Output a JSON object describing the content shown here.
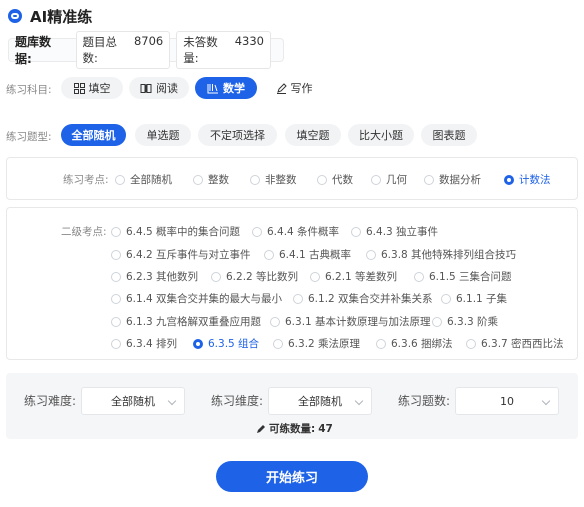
{
  "header": {
    "title": "AI精准练"
  },
  "stats": {
    "label": "题库数据:",
    "total_label": "题目总数:",
    "total_value": "8706",
    "unanswered_label": "未答数量:",
    "unanswered_value": "4330"
  },
  "subject": {
    "label": "练习科目:",
    "items": [
      {
        "label": "填空",
        "icon": "grid-icon"
      },
      {
        "label": "阅读",
        "icon": "book-icon"
      },
      {
        "label": "数学",
        "icon": "math-book-icon",
        "active": true
      },
      {
        "label": "写作",
        "icon": "pencil-icon"
      }
    ]
  },
  "qtype": {
    "label": "练习题型:",
    "items": [
      "全部随机",
      "单选题",
      "不定项选择",
      "填空题",
      "比大小题",
      "图表题"
    ],
    "active": "全部随机"
  },
  "topic": {
    "label": "练习考点:",
    "items": [
      "全部随机",
      "整数",
      "非整数",
      "代数",
      "几何",
      "数据分析",
      "计数法"
    ],
    "selected": "计数法"
  },
  "subtopic": {
    "label": "二级考点:",
    "rows": [
      [
        "6.4.5 概率中的集合问题",
        "6.4.4 条件概率",
        "6.4.3 独立事件"
      ],
      [
        "6.4.2 互斥事件与对立事件",
        "6.4.1 古典概率",
        "6.3.8 其他特殊排列组合技巧"
      ],
      [
        "6.2.3 其他数列",
        "6.2.2 等比数列",
        "6.2.1 等差数列",
        "6.1.5 三集合问题"
      ],
      [
        "6.1.4 双集合交并集的最大与最小",
        "6.1.2 双集合交并补集关系",
        "6.1.1 子集"
      ],
      [
        "6.1.3 九宫格解双重叠应用题",
        "6.3.1 基本计数原理与加法原理",
        "6.3.3 阶乘"
      ],
      [
        "6.3.4 排列",
        "6.3.5 组合",
        "6.3.2 乘法原理",
        "6.3.6 捆绑法",
        "6.3.7 密西西比法"
      ]
    ],
    "selected": "6.3.5 组合"
  },
  "settings": {
    "difficulty_label": "练习难度:",
    "difficulty_value": "全部随机",
    "dimension_label": "练习维度:",
    "dimension_value": "全部随机",
    "count_label": "练习题数:",
    "count_value": "10",
    "available_label": "可练数量:",
    "available_value": "47"
  },
  "start_button": "开始练习",
  "colors": {
    "accent": "#1e62e8"
  }
}
